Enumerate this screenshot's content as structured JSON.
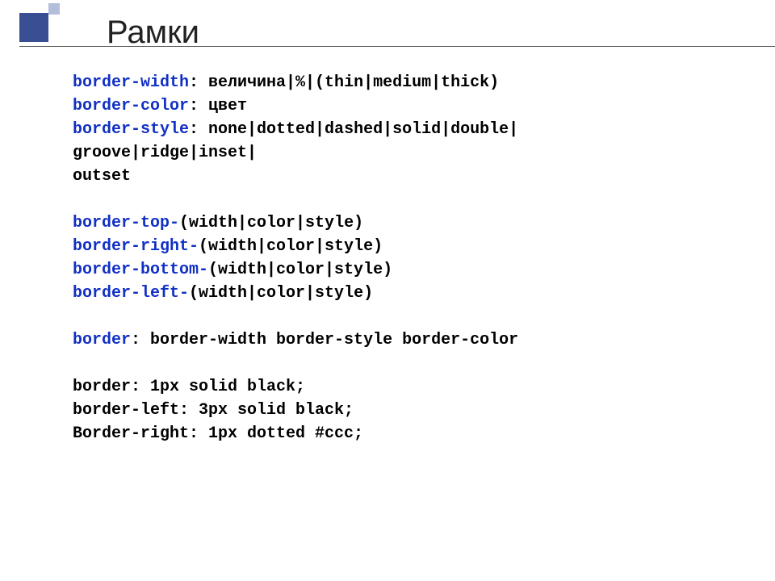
{
  "slide": {
    "title": "Рамки",
    "lines": [
      {
        "segments": [
          {
            "t": "kw",
            "v": "border-width"
          },
          {
            "t": "plain",
            "v": ": величина|%|(thin|medium|thick)"
          }
        ]
      },
      {
        "segments": [
          {
            "t": "kw",
            "v": "border-color"
          },
          {
            "t": "plain",
            "v": ": цвет"
          }
        ]
      },
      {
        "segments": [
          {
            "t": "kw",
            "v": "border-style"
          },
          {
            "t": "plain",
            "v": ": none|dotted|dashed|solid|double|"
          }
        ]
      },
      {
        "segments": [
          {
            "t": "plain",
            "v": "groove|ridge|inset|"
          }
        ]
      },
      {
        "segments": [
          {
            "t": "plain",
            "v": "outset"
          }
        ]
      },
      {
        "segments": [
          {
            "t": "plain",
            "v": ""
          }
        ]
      },
      {
        "segments": [
          {
            "t": "kw",
            "v": "border-top-"
          },
          {
            "t": "plain",
            "v": "(width|color|style)"
          }
        ]
      },
      {
        "segments": [
          {
            "t": "kw",
            "v": "border-right-"
          },
          {
            "t": "plain",
            "v": "(width|color|style)"
          }
        ]
      },
      {
        "segments": [
          {
            "t": "kw",
            "v": "border-bottom-"
          },
          {
            "t": "plain",
            "v": "(width|color|style)"
          }
        ]
      },
      {
        "segments": [
          {
            "t": "kw",
            "v": "border-left-"
          },
          {
            "t": "plain",
            "v": "(width|color|style)"
          }
        ]
      },
      {
        "segments": [
          {
            "t": "plain",
            "v": ""
          }
        ]
      },
      {
        "segments": [
          {
            "t": "kw",
            "v": "border"
          },
          {
            "t": "plain",
            "v": ": border-width border-style border-color"
          }
        ]
      },
      {
        "segments": [
          {
            "t": "plain",
            "v": ""
          }
        ]
      },
      {
        "segments": [
          {
            "t": "plain",
            "v": "border: 1px solid black;"
          }
        ]
      },
      {
        "segments": [
          {
            "t": "plain",
            "v": "border-left: 3px solid black;"
          }
        ]
      },
      {
        "segments": [
          {
            "t": "plain",
            "v": "Border-right: 1px dotted #ccc;"
          }
        ]
      }
    ]
  }
}
